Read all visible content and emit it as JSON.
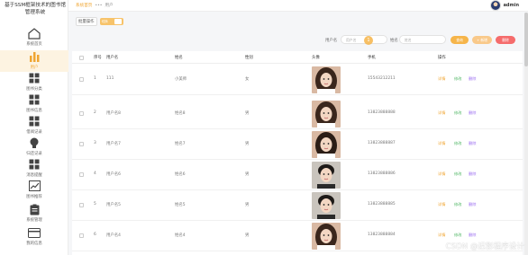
{
  "system_title": "基于SSM框架技术的图书馆管理系统",
  "sidebar": {
    "items": [
      {
        "label": "系统首页",
        "icon": "home-icon",
        "active": false
      },
      {
        "label": "用户",
        "icon": "bar-chart-icon",
        "active": true
      },
      {
        "label": "图书分类",
        "icon": "grid-icon",
        "active": false
      },
      {
        "label": "图书信息",
        "icon": "grid-icon",
        "active": false
      },
      {
        "label": "借阅记录",
        "icon": "grid-icon",
        "active": false
      },
      {
        "label": "归还记录",
        "icon": "bulb-icon",
        "active": false
      },
      {
        "label": "消息提醒",
        "icon": "grid-icon",
        "active": false
      },
      {
        "label": "图书推荐",
        "icon": "line-chart-icon",
        "active": false
      },
      {
        "label": "系统管理",
        "icon": "clipboard-icon",
        "active": false
      },
      {
        "label": "我的信息",
        "icon": "card-icon",
        "active": false
      }
    ]
  },
  "header": {
    "breadcrumb": [
      "系统首页",
      "•••",
      "用户"
    ],
    "username": "admin"
  },
  "toolbar": {
    "mode_label": "批量操作",
    "toggle_text": "切换"
  },
  "search": {
    "label_account": "用户名",
    "placeholder_account": "用户名",
    "label_name": "姓名",
    "placeholder_name": "姓名",
    "btn_search": "查询",
    "btn_add": "+ 新增",
    "btn_delete": "删除",
    "cursor_badge": "1"
  },
  "table": {
    "columns": [
      "",
      "序号",
      "用户名",
      "姓名",
      "性别",
      "头像",
      "手机",
      "操作"
    ],
    "actions": {
      "detail": "详情",
      "edit": "修改",
      "delete": "删除"
    },
    "rows": [
      {
        "index": "1",
        "account": "111",
        "name": "小美师",
        "gender": "女",
        "phone": "15543212211",
        "photo": "female"
      },
      {
        "index": "2",
        "account": "用户名8",
        "name": "姓名8",
        "gender": "男",
        "phone": "13823888888",
        "photo": "female2"
      },
      {
        "index": "3",
        "account": "用户名7",
        "name": "姓名7",
        "gender": "男",
        "phone": "13823888887",
        "photo": "female3"
      },
      {
        "index": "4",
        "account": "用户名6",
        "name": "姓名6",
        "gender": "男",
        "phone": "13823888886",
        "photo": "male"
      },
      {
        "index": "5",
        "account": "用户名5",
        "name": "姓名5",
        "gender": "男",
        "phone": "13823888885",
        "photo": "male2"
      },
      {
        "index": "6",
        "account": "用户名4",
        "name": "姓名4",
        "gender": "男",
        "phone": "13823888884",
        "photo": "female4"
      }
    ]
  },
  "colors": {
    "accent": "#f0a531",
    "edit": "#56b96a",
    "delete": "#9a6cf0",
    "delete_button": "#f56c6c"
  },
  "watermark": "CSDN @迟影程序设计"
}
